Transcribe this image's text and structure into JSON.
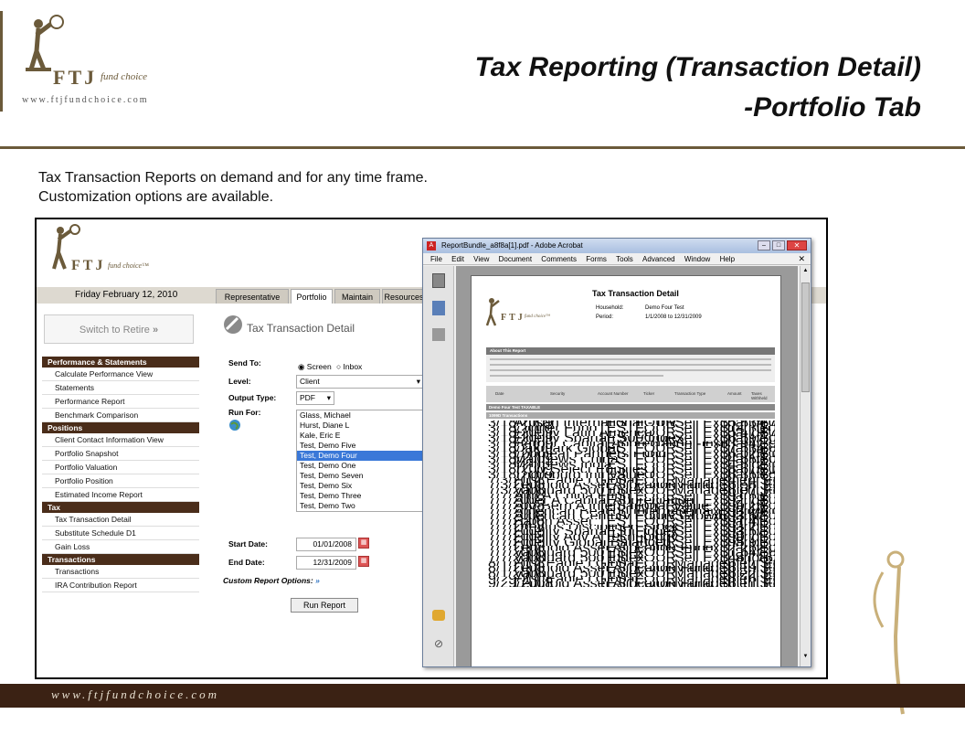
{
  "slide": {
    "title_line1": "Tax Reporting (Transaction Detail)",
    "title_line2": "-Portfolio Tab",
    "intro_line1": "Tax Transaction Reports on demand and for any time frame.",
    "intro_line2": "Customization options are available.",
    "brand_ftj": "FTJ",
    "brand_fundchoice": "fund choice",
    "brand_url": "www.ftjfundchoice.com",
    "footer_url": "www.ftjfundchoice.com"
  },
  "colors": {
    "brand": "#6b5a3a",
    "footer_band": "#3b2214",
    "nav_head": "#4a2d1a",
    "selected": "#3a78d8"
  },
  "app": {
    "brand_ftj": "FTJ",
    "brand_fundchoice": "fund choice™",
    "date": "Friday February 12, 2010",
    "tabs": [
      "Representative",
      "Portfolio",
      "Maintain",
      "Resources"
    ],
    "switch_retire": "Switch to Retire",
    "nav": [
      {
        "head": "Performance & Statements",
        "items": [
          "Calculate Performance View",
          "Statements",
          "Performance Report",
          "Benchmark Comparison"
        ]
      },
      {
        "head": "Positions",
        "items": [
          "Client Contact Information View",
          "Portfolio Snapshot",
          "Portfolio Valuation",
          "Portfolio Position",
          "Estimated Income Report"
        ]
      },
      {
        "head": "Tax",
        "items": [
          "Tax Transaction Detail",
          "Substitute Schedule D1",
          "Gain Loss"
        ]
      },
      {
        "head": "Transactions",
        "items": [
          "Transactions",
          "IRA Contribution Report"
        ]
      }
    ],
    "form": {
      "title": "Tax Transaction Detail",
      "send_to_label": "Send To:",
      "send_screen": "Screen",
      "send_inbox": "Inbox",
      "level_label": "Level:",
      "level_value": "Client",
      "output_label": "Output Type:",
      "output_value": "PDF",
      "run_for_label": "Run For:",
      "run_for_options": [
        "Glass, Michael",
        "Hurst, Diane L",
        "Kale, Eric E",
        "Test, Demo Five",
        "Test, Demo Four",
        "Test, Demo One",
        "Test, Demo Seven",
        "Test, Demo Six",
        "Test, Demo Three",
        "Test, Demo Two"
      ],
      "run_for_selected": "Test, Demo Four",
      "start_label": "Start Date:",
      "start_value": "01/01/2008",
      "end_label": "End Date:",
      "end_value": "12/31/2009",
      "custom_label": "Custom Report Options:",
      "run_button": "Run Report"
    }
  },
  "acrobat": {
    "title": "ReportBundle_a8f8a[1].pdf - Adobe Acrobat",
    "menu": [
      "File",
      "Edit",
      "View",
      "Document",
      "Comments",
      "Forms",
      "Tools",
      "Advanced",
      "Window",
      "Help"
    ],
    "report_title": "Tax Transaction Detail",
    "household_label": "Household:",
    "household_value": "Demo Four Test",
    "period_label": "Period:",
    "period_value": "1/1/2008 to 12/31/2009",
    "about_head": "About This Report",
    "columns": [
      "Date",
      "Security",
      "Account Number",
      "Ticker",
      "Transaction Type",
      "Amount",
      "Taxes Withheld"
    ],
    "group": "Demo Four Test TAXABLE",
    "subgroup": "1099D Transactions",
    "rows": [
      [
        "3/18/2009",
        "Artisan International - Inv",
        "TESTFOUR",
        "Sell Exchange",
        "$5,834.74",
        "$0.00"
      ],
      [
        "3/18/2009",
        "Clipper Fund",
        "TESTFOUR",
        "Sell Exchange",
        "$14,301.38",
        "$0.00"
      ],
      [
        "3/18/2009",
        "Fidelity Latin America",
        "TESTFOUR",
        "Sell Exchange",
        "$5,479.75",
        "$0.00"
      ],
      [
        "3/18/2009",
        "Fidelity Spartan 500 Index",
        "TESTFOUR",
        "Sell Exchange",
        "$6,597.08",
        "$0.00"
      ],
      [
        "3/18/2009",
        "Harbor Capital Appreciation -Instl",
        "TESTFOUR",
        "Sell Exchange",
        "$3,947.94",
        "$0.00"
      ],
      [
        "3/18/2009",
        "Oakmark Global",
        "TESTFOUR",
        "Sell Exchange",
        "$7,534.89",
        "$0.00"
      ],
      [
        "3/18/2009",
        "Longleaf Partners Fund",
        "TESTFOUR",
        "Sell Exchange",
        "$6,026.17",
        "$0.00"
      ],
      [
        "3/18/2009",
        "Matthews China",
        "TESTFOUR",
        "Sell Exchange",
        "$4,680.01",
        "$0.00"
      ],
      [
        "3/18/2009",
        "Matthews India",
        "TESTFOUR",
        "Sell Exchange",
        "$4,612.10",
        "$0.00"
      ],
      [
        "3/18/2009",
        "TCW Select Equities I",
        "TESTFOUR",
        "Sell Exchange",
        "$8,678.11",
        "$0.00"
      ],
      [
        "3/18/2009",
        "Thornburg Intl Value I",
        "TESTFOUR",
        "Sell Exchange",
        "$6,353.54",
        "$0.00"
      ],
      [
        "7/3/2008",
        "First Eagle I Global",
        "TESTFOUR",
        "Management Fee",
        "$4.14",
        "$0.00"
      ],
      [
        "7/3/2008",
        "Leuthold Asset Allocation Fund",
        "TESTFOUR",
        "Management Fee",
        "$6.58",
        "$0.00"
      ],
      [
        "7/3/2008",
        "Vanguard 500 Index",
        "TESTFOUR",
        "Management Fee",
        "$6.07",
        "$0.00"
      ],
      [
        "7/7/2008",
        "Aim A China Fund",
        "TESTFOUR",
        "Sell Exchange",
        "$91.63",
        "$0.00"
      ],
      [
        "7/7/2008",
        "Alger A Capital Appreciation",
        "TESTFOUR",
        "Sell Exchange",
        "$92.79",
        "$0.00"
      ],
      [
        "7/7/2008",
        "AIV-Bern A International Value",
        "TESTFOUR",
        "Sell Exchange",
        "$90.26",
        "$0.00"
      ],
      [
        "7/7/2008",
        "American Beacon International Equity - Inv",
        "TESTFOUR",
        "Sell Exchange",
        "$93.24",
        "$0.00"
      ],
      [
        "7/7/2008",
        "American Century Equity Growth - Inv",
        "TESTFOUR",
        "Sell Exchange",
        "$93.67",
        "$0.00"
      ],
      [
        "7/7/2008",
        "Baron Asset",
        "TESTFOUR",
        "Sell Exchange",
        "$91.41",
        "$0.00"
      ],
      [
        "7/7/2008",
        "Dreyfus Disciplined Stock",
        "TESTFOUR",
        "Sell Exchange",
        "$93.21",
        "$0.00"
      ],
      [
        "7/7/2008",
        "Fidelity Spartan Intl Index",
        "TESTFOUR",
        "Sell Exchange",
        "$93.57",
        "$0.00"
      ],
      [
        "7/7/2008",
        "Fidelity Adv A Technology",
        "TESTFOUR",
        "Sell Exchange",
        "$90.71",
        "$0.00"
      ],
      [
        "7/7/2008",
        "Fidelity Global Balanced",
        "TESTFOUR",
        "Sell Exchange",
        "$95.91",
        "$0.00"
      ],
      [
        "7/7/2008",
        "Leuthold Asset Allocation Fund",
        "TESTFOUR",
        "Sell Exchange",
        "$2,262.00",
        "$0.00"
      ],
      [
        "7/7/2008",
        "Vanguard 500 Index",
        "TESTFOUR",
        "Sell Exchange",
        "$1,647.87",
        "$0.00"
      ],
      [
        "7/7/2008",
        "Vanguard 500 Index",
        "TESTFOUR",
        "Sell Exchange",
        "$461.76",
        "$0.00"
      ],
      [
        "8/1/2008",
        "First Eagle I Global",
        "TESTFOUR",
        "Management Fee",
        "$6.17",
        "$0.00"
      ],
      [
        "8/1/2008",
        "Leuthold Asset Allocation Fund",
        "TESTFOUR",
        "Management Fee",
        "$6.19",
        "$0.00"
      ],
      [
        "8/1/2008",
        "Vanguard 500 Index",
        "TESTFOUR",
        "Management Fee",
        "$6.22",
        "$0.00"
      ],
      [
        "9/29/2008",
        "First Eagle I Global",
        "TESTFOUR",
        "Management Fee",
        "$6.16",
        "$0.00"
      ],
      [
        "9/29/2008",
        "Leuthold Asset Allocation Fund",
        "TESTFOUR",
        "Management Fee",
        "$6.11",
        "$0.00"
      ]
    ]
  }
}
